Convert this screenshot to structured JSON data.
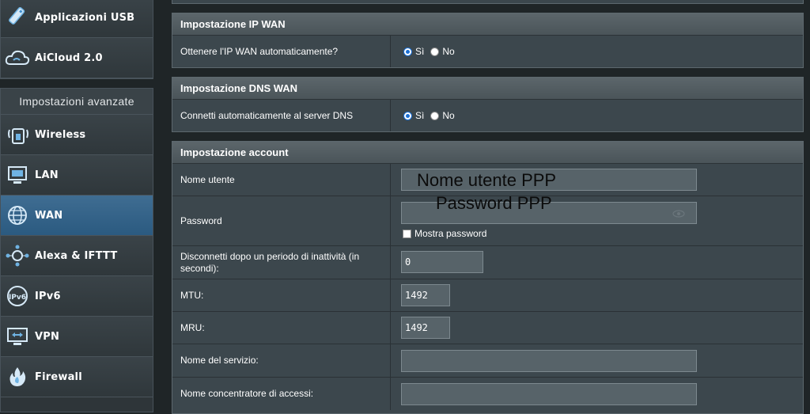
{
  "sidebar": {
    "top_items": [
      {
        "label": "Applicazioni USB",
        "icon": "usb-app-icon"
      },
      {
        "label": "AiCloud 2.0",
        "icon": "cloud-icon"
      }
    ],
    "advanced_header": "Impostazioni avanzate",
    "items": [
      {
        "label": "Wireless",
        "icon": "wireless-icon"
      },
      {
        "label": "LAN",
        "icon": "lan-icon"
      },
      {
        "label": "WAN",
        "icon": "globe-icon",
        "active": true
      },
      {
        "label": "Alexa & IFTTT",
        "icon": "alexa-icon"
      },
      {
        "label": "IPv6",
        "icon": "ipv6-icon"
      },
      {
        "label": "VPN",
        "icon": "vpn-icon"
      },
      {
        "label": "Firewall",
        "icon": "firewall-icon"
      }
    ]
  },
  "wan_ip": {
    "title": "Impostazione IP WAN",
    "label": "Ottenere l'IP WAN automaticamente?",
    "options": [
      "Sì",
      "No"
    ],
    "selected": "Sì"
  },
  "wan_dns": {
    "title": "Impostazione DNS WAN",
    "label": "Connetti automaticamente al server DNS",
    "options": [
      "Sì",
      "No"
    ],
    "selected": "Sì"
  },
  "account": {
    "title": "Impostazione account",
    "username_label": "Nome utente",
    "username_overlay": "Nome utente PPP",
    "password_label": "Password",
    "password_overlay": "Password PPP",
    "show_password_label": "Mostra password",
    "idle_label": "Disconnetti dopo un periodo di inattività (in secondi):",
    "idle_value": "0",
    "mtu_label": "MTU:",
    "mtu_value": "1492",
    "mru_label": "MRU:",
    "mru_value": "1492",
    "service_label": "Nome del servizio:",
    "service_value": "",
    "concentrator_label": "Nome concentratore di accessi:",
    "concentrator_value": ""
  },
  "colors": {
    "active_menu": "#2b5a80",
    "section_bg": "#3c474d",
    "radio_accent": "#1a6fd6"
  }
}
